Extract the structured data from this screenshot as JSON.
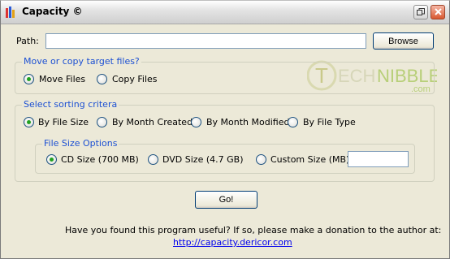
{
  "window": {
    "title": "Capacity ©"
  },
  "path": {
    "label": "Path:",
    "value": "",
    "browse_label": "Browse"
  },
  "target_group": {
    "legend": "Move or copy target files?",
    "options": [
      {
        "label": "Move Files",
        "checked": true
      },
      {
        "label": "Copy Files",
        "checked": false
      }
    ]
  },
  "sort_group": {
    "legend": "Select sorting critera",
    "options": [
      {
        "label": "By File Size",
        "checked": true
      },
      {
        "label": "By Month Created",
        "checked": false
      },
      {
        "label": "By Month Modified",
        "checked": false
      },
      {
        "label": "By File Type",
        "checked": false
      }
    ],
    "size_options": {
      "legend": "File Size Options",
      "options": [
        {
          "label": "CD Size (700 MB)",
          "checked": true
        },
        {
          "label": "DVD Size (4.7 GB)",
          "checked": false
        },
        {
          "label": "Custom Size (MB)",
          "checked": false
        }
      ],
      "custom_value": ""
    }
  },
  "go_label": "Go!",
  "footer": {
    "message": "Have you found this program useful?  If so, please make a donation to the author at:",
    "link": "http://capacity.dericor.com"
  },
  "watermark": {
    "part1": "Tech",
    "part2": "nibble",
    "suffix": ".com"
  }
}
